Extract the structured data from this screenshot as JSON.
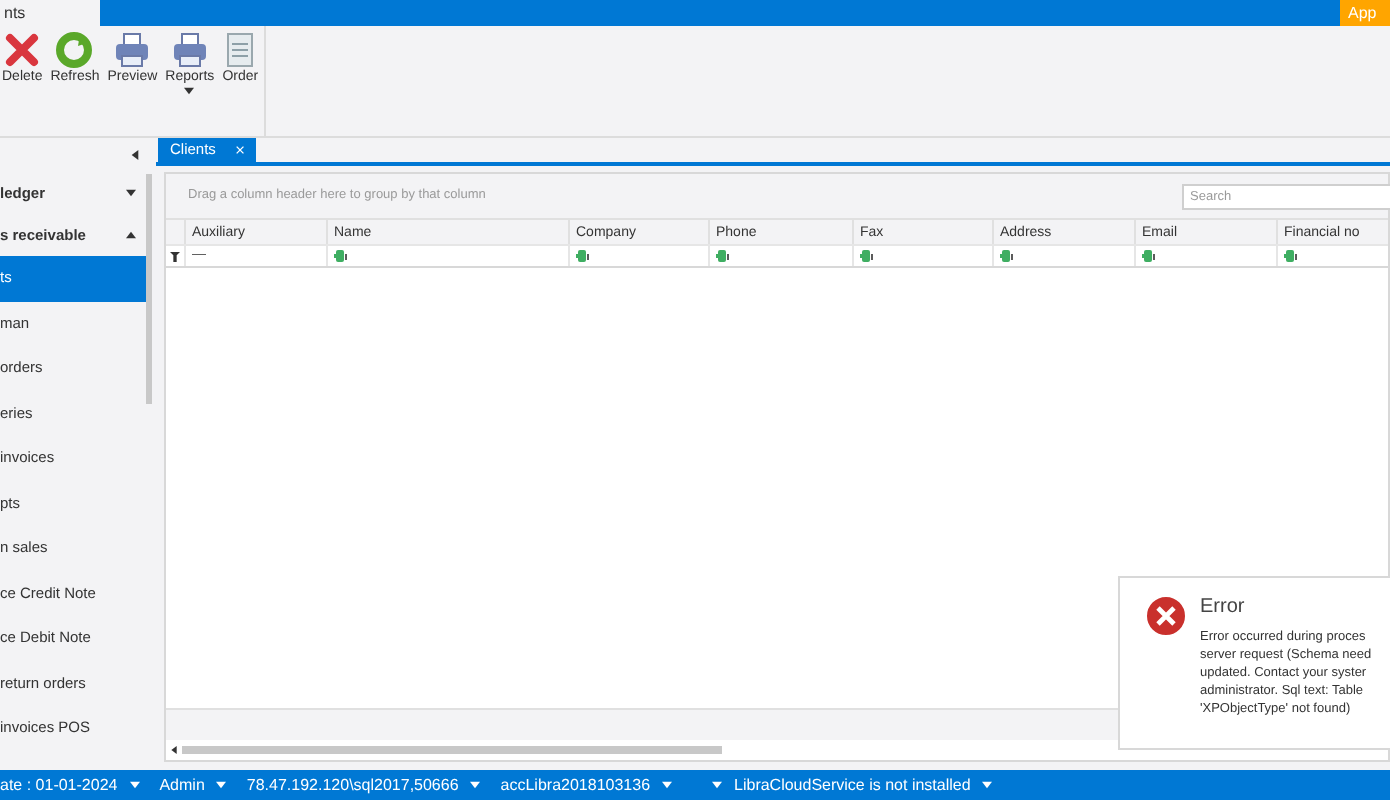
{
  "app_tabs": [
    {
      "label": "nts",
      "selected": true
    }
  ],
  "app_button": {
    "label": "App"
  },
  "ribbon": {
    "buttons": [
      {
        "label": "Delete",
        "kind": "delete",
        "dropdown": false
      },
      {
        "label": "Refresh",
        "kind": "refresh",
        "dropdown": false
      },
      {
        "label": "Preview",
        "kind": "print",
        "dropdown": false
      },
      {
        "label": "Reports",
        "kind": "print",
        "dropdown": true
      },
      {
        "label": "Order",
        "kind": "document",
        "dropdown": false
      }
    ]
  },
  "sidebar": {
    "groups": [
      {
        "label": "ledger",
        "expanded": false
      },
      {
        "label": "s receivable",
        "expanded": true,
        "children": [
          {
            "label": "ts",
            "selected": true
          },
          {
            "label": "man",
            "selected": false
          },
          {
            "label": "orders",
            "selected": false
          },
          {
            "label": "eries",
            "selected": false
          },
          {
            "label": "invoices",
            "selected": false
          },
          {
            "label": "pts",
            "selected": false
          },
          {
            "label": "n sales",
            "selected": false
          },
          {
            "label": "ce Credit Note",
            "selected": false
          },
          {
            "label": "ce Debit Note",
            "selected": false
          },
          {
            "label": "return orders",
            "selected": false
          },
          {
            "label": "invoices POS",
            "selected": false
          }
        ]
      }
    ]
  },
  "doc_tabs": [
    {
      "label": "Clients",
      "selected": true
    }
  ],
  "grid": {
    "group_panel": "Drag a column header here to group by that column",
    "search": {
      "placeholder": "Search"
    },
    "columns": [
      "Auxiliary",
      "Name",
      "Company",
      "Phone",
      "Fax",
      "Address",
      "Email",
      "Financial no"
    ],
    "filter_row": [
      {
        "kind": "text",
        "text": "—"
      },
      {
        "kind": "icon"
      },
      {
        "kind": "icon"
      },
      {
        "kind": "icon"
      },
      {
        "kind": "icon"
      },
      {
        "kind": "icon"
      },
      {
        "kind": "icon"
      },
      {
        "kind": "icon"
      }
    ]
  },
  "error_popup": {
    "title": "Error",
    "message": "Error occurred during proces\nserver request (Schema need\nupdated. Contact your syster\nadministrator. Sql text: Table\n'XPObjectType' not found)"
  },
  "status_bar": [
    {
      "text": "ate : 01-01-2024",
      "dropdown": true
    },
    {
      "text": "Admin",
      "dropdown": true
    },
    {
      "text": "78.47.192.120\\sql2017,50666",
      "dropdown": true
    },
    {
      "text": "accLibra2018103136",
      "dropdown": true
    },
    {
      "text": "LibraCloudService is not installed",
      "dropdown": true,
      "leading_caret": true
    }
  ]
}
